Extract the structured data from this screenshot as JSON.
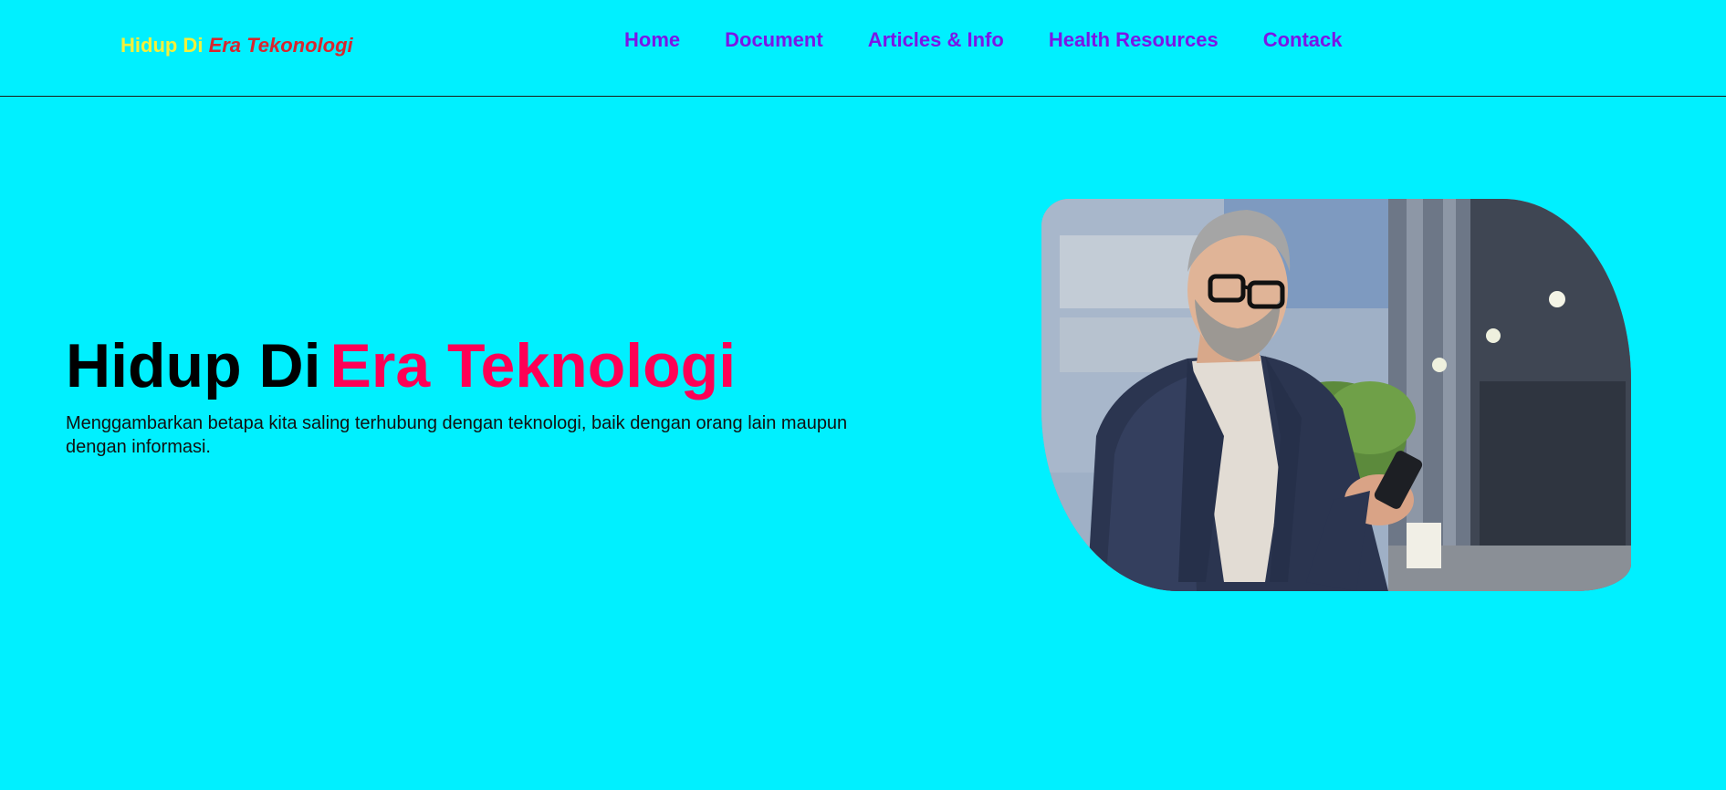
{
  "navbar": {
    "brand_part1": "Hidup Di",
    "brand_part2": "Era Tekonologi",
    "links": [
      {
        "label": "Home"
      },
      {
        "label": "Document"
      },
      {
        "label": "Articles & Info"
      },
      {
        "label": "Health Resources"
      },
      {
        "label": "Contack"
      }
    ]
  },
  "hero": {
    "title_part1": "Hidup Di",
    "title_part2": "Era Teknologi",
    "description": "Menggambarkan betapa kita saling terhubung dengan teknologi, baik dengan orang lain maupun dengan informasi."
  },
  "colors": {
    "background": "#00F0FF",
    "nav_link": "#7B16E6",
    "brand_yellow": "#F4F03A",
    "brand_red": "#D8262E",
    "title_accent": "#FF0055"
  }
}
